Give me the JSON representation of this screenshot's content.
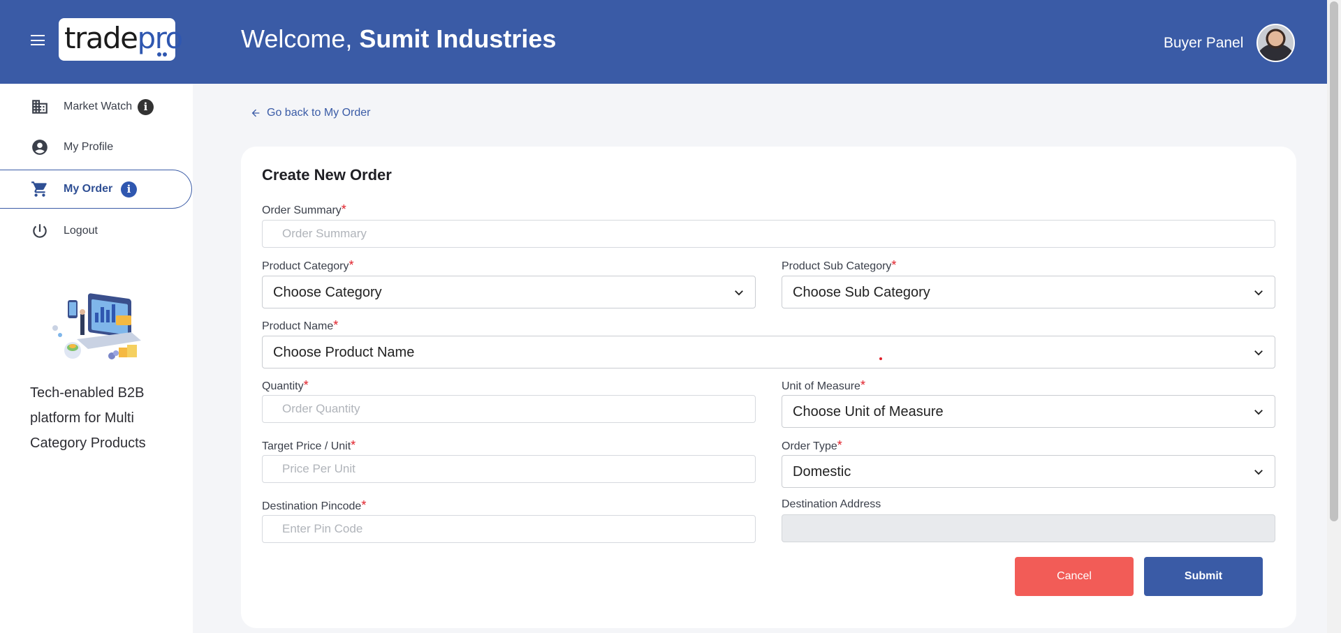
{
  "header": {
    "brand_part1": "trade",
    "brand_part2": "pro",
    "welcome_prefix": "Welcome, ",
    "company_name": "Sumit Industries",
    "panel_label": "Buyer Panel"
  },
  "sidebar": {
    "items": [
      {
        "label": "Market Watch",
        "icon": "building-icon",
        "info": "i"
      },
      {
        "label": "My Profile",
        "icon": "user-circle-icon"
      },
      {
        "label": "My Order",
        "icon": "cart-icon",
        "info": "i"
      },
      {
        "label": "Logout",
        "icon": "power-icon"
      }
    ],
    "tagline": "Tech-enabled B2B platform for Multi Category Products"
  },
  "back_link": "Go back to My Order",
  "form": {
    "title": "Create New Order",
    "required_mark": "*",
    "order_summary": {
      "label": "Order Summary",
      "placeholder": "Order Summary"
    },
    "product_category": {
      "label": "Product Category",
      "value": "Choose Category"
    },
    "product_sub_category": {
      "label": "Product Sub Category",
      "value": "Choose Sub Category"
    },
    "product_name": {
      "label": "Product Name",
      "value": "Choose Product Name"
    },
    "quantity": {
      "label": "Quantity",
      "placeholder": "Order Quantity"
    },
    "unit_of_measure": {
      "label": "Unit of Measure",
      "value": "Choose Unit of Measure"
    },
    "target_price": {
      "label": "Target Price / Unit",
      "placeholder": "Price Per Unit"
    },
    "order_type": {
      "label": "Order Type",
      "value": "Domestic"
    },
    "destination_pincode": {
      "label": "Destination Pincode",
      "placeholder": "Enter Pin Code"
    },
    "destination_address": {
      "label": "Destination Address",
      "value": ""
    },
    "cancel_label": "Cancel",
    "submit_label": "Submit"
  },
  "colors": {
    "primary": "#3a5ba6",
    "danger": "#f25c57",
    "required": "#e0202a"
  }
}
